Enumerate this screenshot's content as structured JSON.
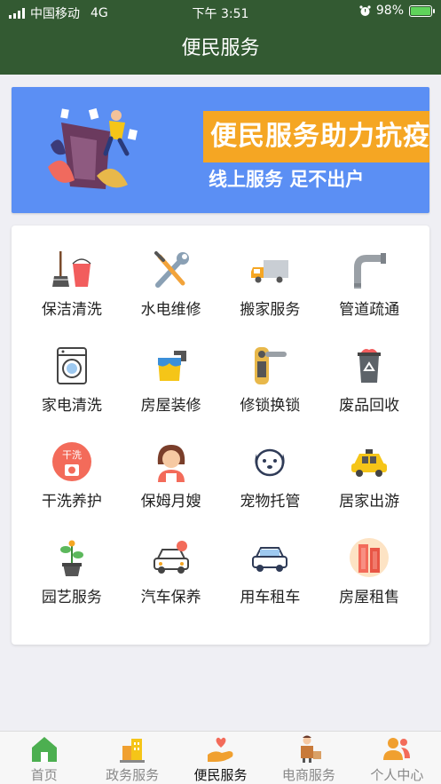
{
  "status_bar": {
    "carrier": "中国移动",
    "network": "4G",
    "time": "下午 3:51",
    "battery": "98%",
    "battery_level": 0.98
  },
  "header": {
    "title": "便民服务"
  },
  "banner": {
    "headline": "便民服务助力抗疫",
    "subline": "线上服务  足不出户",
    "headline_bg": "#f5a623",
    "bg": "#5b8ff4"
  },
  "services": [
    {
      "label": "保洁清洗",
      "icon": "mop-bucket-icon"
    },
    {
      "label": "水电维修",
      "icon": "wrench-screwdriver-icon"
    },
    {
      "label": "搬家服务",
      "icon": "moving-truck-icon"
    },
    {
      "label": "管道疏通",
      "icon": "pipe-icon"
    },
    {
      "label": "家电清洗",
      "icon": "washing-machine-icon"
    },
    {
      "label": "房屋装修",
      "icon": "paint-bucket-icon"
    },
    {
      "label": "修锁换锁",
      "icon": "door-lock-icon"
    },
    {
      "label": "废品回收",
      "icon": "recycle-bin-icon"
    },
    {
      "label": "干洗养护",
      "icon": "dry-clean-icon",
      "badge": "干洗"
    },
    {
      "label": "保姆月嫂",
      "icon": "nanny-icon"
    },
    {
      "label": "宠物托管",
      "icon": "dog-icon"
    },
    {
      "label": "居家出游",
      "icon": "taxi-icon"
    },
    {
      "label": "园艺服务",
      "icon": "potted-plant-icon"
    },
    {
      "label": "汽车保养",
      "icon": "car-service-icon"
    },
    {
      "label": "用车租车",
      "icon": "car-rental-icon"
    },
    {
      "label": "房屋租售",
      "icon": "building-icon"
    }
  ],
  "tabs": [
    {
      "label": "首页",
      "icon": "home-icon",
      "active": false
    },
    {
      "label": "政务服务",
      "icon": "government-building-icon",
      "active": false
    },
    {
      "label": "便民服务",
      "icon": "heart-hand-icon",
      "active": true
    },
    {
      "label": "电商服务",
      "icon": "delivery-person-icon",
      "active": false
    },
    {
      "label": "个人中心",
      "icon": "user-profile-icon",
      "active": false
    }
  ],
  "colors": {
    "header_bg": "#335a32",
    "accent_orange": "#f5a623",
    "tab_green": "#4caf50",
    "tab_orange": "#f0a030"
  }
}
